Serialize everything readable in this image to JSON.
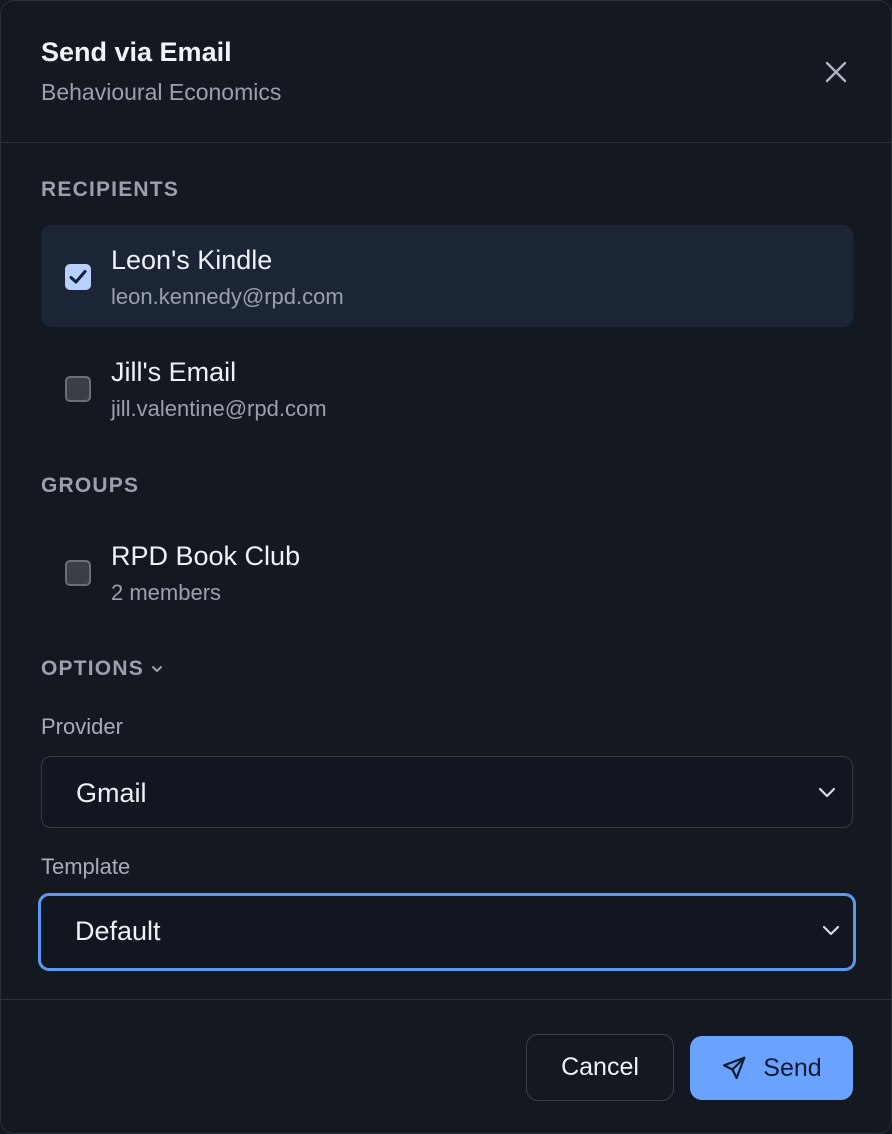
{
  "dialog": {
    "title": "Send via Email",
    "subtitle": "Behavioural Economics",
    "close_icon": "close-icon"
  },
  "recipients": {
    "section_label": "RECIPIENTS",
    "items": [
      {
        "name": "Leon's Kindle",
        "email": "leon.kennedy@rpd.com",
        "checked": true
      },
      {
        "name": "Jill's Email",
        "email": "jill.valentine@rpd.com",
        "checked": false
      }
    ]
  },
  "groups": {
    "section_label": "GROUPS",
    "items": [
      {
        "name": "RPD Book Club",
        "members": "2 members",
        "checked": false
      }
    ]
  },
  "options": {
    "label": "OPTIONS",
    "toggle_icon": "chevron-down-icon",
    "provider": {
      "label": "Provider",
      "value": "Gmail"
    },
    "template": {
      "label": "Template",
      "value": "Default"
    }
  },
  "footer": {
    "cancel_label": "Cancel",
    "send_label": "Send",
    "send_icon": "paper-plane-icon"
  },
  "colors": {
    "background": "#141820",
    "accent": "#6aa3ff",
    "focus_ring": "#5f97ee",
    "selected_row": "#1c2535",
    "checkbox_checked": "#b8d0ff"
  }
}
